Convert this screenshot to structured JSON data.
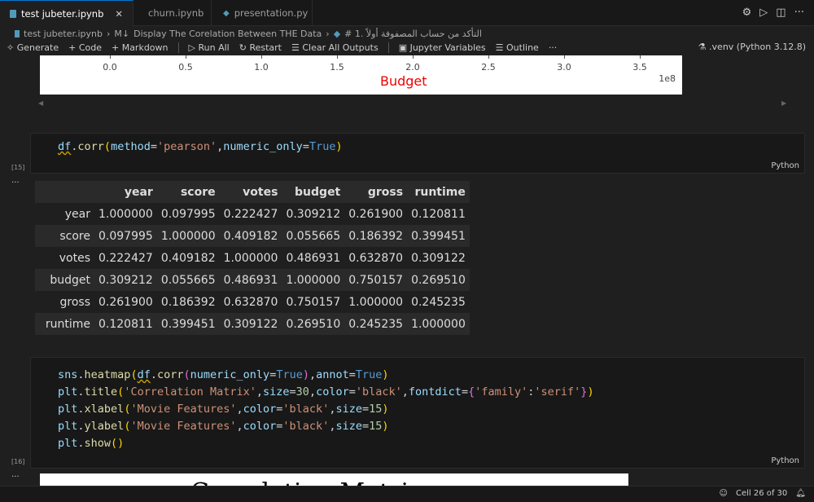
{
  "tabs": [
    {
      "label": "test jubeter.ipynb",
      "active": true
    },
    {
      "label": "churn.ipynb"
    },
    {
      "label": "presentation.py"
    }
  ],
  "breadcrumb": [
    "test jubeter.ipynb",
    "Display The Corelation Between THE Data",
    "# 1. التأكد من حساب المصفوفة أولاً"
  ],
  "toolbar": {
    "generate": "Generate",
    "code": "Code",
    "markdown": "Markdown",
    "run_all": "Run All",
    "restart": "Restart",
    "clear": "Clear All Outputs",
    "variables": "Jupyter Variables",
    "outline": "Outline",
    "more": "···"
  },
  "kernel": ".venv (Python 3.12.8)",
  "plot_top": {
    "ticks": [
      "0.0",
      "0.5",
      "1.0",
      "1.5",
      "2.0",
      "2.5",
      "3.0",
      "3.5"
    ],
    "xlabel": "Budget",
    "offset": "1e8",
    "xlabel_color": "#ff0000"
  },
  "cell15": {
    "count": "[15]",
    "lang": "Python"
  },
  "cell16": {
    "count": "[16]",
    "lang": "Python"
  },
  "corr_table": {
    "columns": [
      "year",
      "score",
      "votes",
      "budget",
      "gross",
      "runtime"
    ],
    "rows": [
      [
        "year",
        "1.000000",
        "0.097995",
        "0.222427",
        "0.309212",
        "0.261900",
        "0.120811"
      ],
      [
        "score",
        "0.097995",
        "1.000000",
        "0.409182",
        "0.055665",
        "0.186392",
        "0.399451"
      ],
      [
        "votes",
        "0.222427",
        "0.409182",
        "1.000000",
        "0.486931",
        "0.632870",
        "0.309122"
      ],
      [
        "budget",
        "0.309212",
        "0.055665",
        "0.486931",
        "1.000000",
        "0.750157",
        "0.269510"
      ],
      [
        "gross",
        "0.261900",
        "0.186392",
        "0.632870",
        "0.750157",
        "1.000000",
        "0.245235"
      ],
      [
        "runtime",
        "0.120811",
        "0.399451",
        "0.309122",
        "0.269510",
        "0.245235",
        "1.000000"
      ]
    ]
  },
  "plot_bottom_title": "Correlation Matrix",
  "status": {
    "cell": "Cell 26 of 30"
  }
}
